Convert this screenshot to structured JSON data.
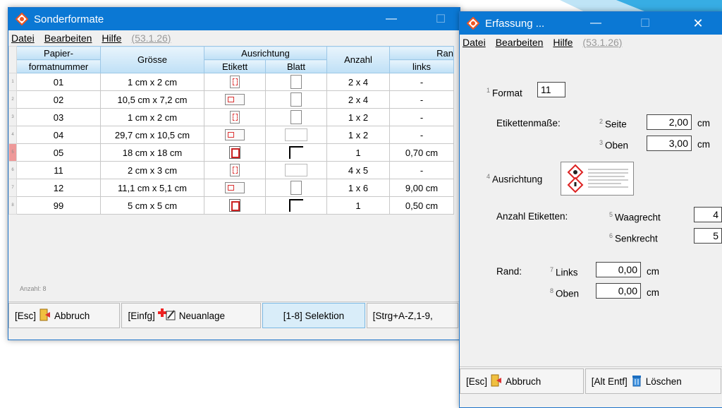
{
  "colors": {
    "titlebar": "#0b78d4",
    "header": "#bfe0f6",
    "accent_red": "#d33"
  },
  "win1": {
    "title": "Sonderformate",
    "minimize": "—",
    "maximize": "☐",
    "menu": {
      "file": "Datei",
      "edit": "Bearbeiten",
      "help": "Hilfe",
      "version": "(53.1.26)"
    },
    "headers": {
      "papier": "Papier-",
      "formatnummer": "formatnummer",
      "groesse": "Grösse",
      "ausrichtung": "Ausrichtung",
      "etikett": "Etikett",
      "blatt": "Blatt",
      "anzahl": "Anzahl",
      "rand": "Ran",
      "links": "links"
    },
    "rows": [
      {
        "rn": "1",
        "nr": "01",
        "size": "1 cm x 2 cm",
        "anzahl": "2 x 4",
        "links": "-",
        "etikett": "portrait",
        "blatt": "portrait"
      },
      {
        "rn": "2",
        "nr": "02",
        "size": "10,5 cm x 7,2 cm",
        "anzahl": "2 x 4",
        "links": "-",
        "etikett": "landscape",
        "blatt": "portrait"
      },
      {
        "rn": "3",
        "nr": "03",
        "size": "1 cm x 2 cm",
        "anzahl": "1 x 2",
        "links": "-",
        "etikett": "portrait",
        "blatt": "portrait"
      },
      {
        "rn": "4",
        "nr": "04",
        "size": "29,7 cm x 10,5 cm",
        "anzahl": "1 x 2",
        "links": "-",
        "etikett": "landscape",
        "blatt": "landscape"
      },
      {
        "rn": "5",
        "nr": "05",
        "size": "18 cm x 18 cm",
        "anzahl": "1",
        "links": "0,70 cm",
        "etikett": "symbol",
        "blatt": "border"
      },
      {
        "rn": "6",
        "nr": "11",
        "size": "2 cm x 3 cm",
        "anzahl": "4 x 5",
        "links": "-",
        "etikett": "portrait",
        "blatt": "landscape"
      },
      {
        "rn": "7",
        "nr": "12",
        "size": "11,1 cm x 5,1 cm",
        "anzahl": "1 x 6",
        "links": "9,00 cm",
        "etikett": "landscape",
        "blatt": "portrait"
      },
      {
        "rn": "8",
        "nr": "99",
        "size": "5 cm x 5 cm",
        "anzahl": "1",
        "links": "0,50 cm",
        "etikett": "symbol",
        "blatt": "border"
      }
    ],
    "count": "Anzahl: 8",
    "buttons": {
      "cancel_key": "[Esc]",
      "cancel": "Abbruch",
      "new_key": "[Einfg]",
      "new": "Neuanlage",
      "select": "[1-8] Selektion",
      "jump": "[Strg+A-Z,1-9,"
    }
  },
  "win2": {
    "title": "Erfassung ...",
    "minimize": "—",
    "maximize": "☐",
    "close": "✕",
    "menu": {
      "file": "Datei",
      "edit": "Bearbeiten",
      "help": "Hilfe",
      "version": "(53.1.26)"
    },
    "format": {
      "n": "1",
      "label": "Format",
      "value": "11"
    },
    "masse": {
      "label": "Etikettenmaße:",
      "n_seite": "2",
      "seite": "Seite",
      "seite_val": "2,00",
      "n_oben": "3",
      "oben": "Oben",
      "oben_val": "3,00",
      "unit": "cm"
    },
    "ausrichtung": {
      "n": "4",
      "label": "Ausrichtung"
    },
    "anzahl": {
      "label": "Anzahl Etiketten:",
      "n_w": "5",
      "w": "Waagrecht",
      "w_val": "4",
      "n_s": "6",
      "s": "Senkrecht",
      "s_val": "5"
    },
    "rand": {
      "label": "Rand:",
      "n_l": "7",
      "l": "Links",
      "l_val": "0,00",
      "n_o": "8",
      "o": "Oben",
      "o_val": "0,00",
      "unit": "cm"
    },
    "buttons": {
      "cancel_key": "[Esc]",
      "cancel": "Abbruch",
      "del_key": "[Alt Entf]",
      "del": "Löschen"
    }
  }
}
